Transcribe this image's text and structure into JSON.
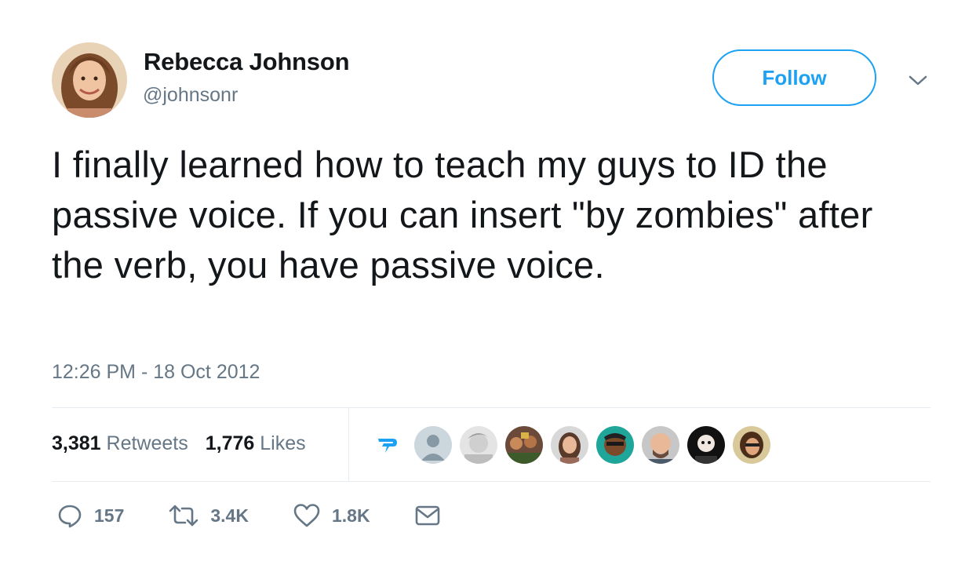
{
  "author": {
    "display_name": "Rebecca Johnson",
    "handle": "@johnsonr"
  },
  "follow_button": {
    "label": "Follow"
  },
  "tweet": {
    "text": "I finally learned how to teach my guys to ID the passive voice. If you can insert \"by zombies\" after the verb, you have passive voice.",
    "timestamp": "12:26 PM - 18 Oct 2012"
  },
  "stats": {
    "retweets_count": "3,381",
    "retweets_label": "Retweets",
    "likes_count": "1,776",
    "likes_label": "Likes"
  },
  "actions": {
    "reply_count": "157",
    "retweet_count": "3.4K",
    "like_count": "1.8K"
  },
  "colors": {
    "accent": "#1da1f2",
    "text": "#14171a",
    "muted": "#657786",
    "divider": "#e6ecf0"
  },
  "icons": [
    "reply-icon",
    "retweet-icon",
    "heart-icon",
    "mail-icon",
    "chevron-down-icon"
  ]
}
